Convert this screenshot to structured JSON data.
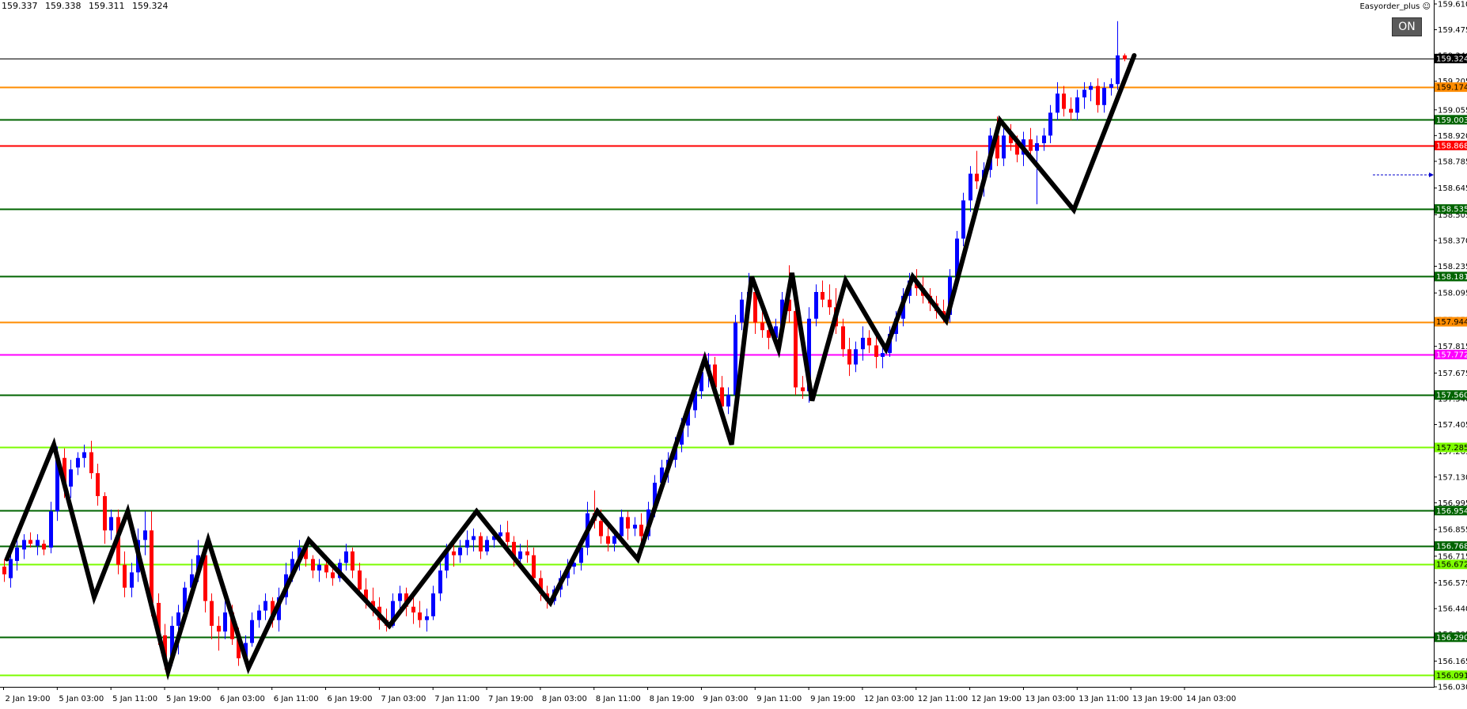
{
  "header": {
    "ohlc": [
      "159.337",
      "159.338",
      "159.311",
      "159.324"
    ],
    "ea_label": "Easyorder_plus",
    "ea_icon": "smiley-icon",
    "on_button": "ON"
  },
  "colors": {
    "bull": "#0000ff",
    "bear": "#ff0000",
    "zigzag": "#000000",
    "price_line": "#000000",
    "dark_green": "#006400",
    "orange": "#ff8c00",
    "red": "#ff0000",
    "magenta": "#ff00ff",
    "lime": "#7cfc00"
  },
  "chart_data": {
    "type": "candlestick",
    "ylim": [
      156.03,
      159.61
    ],
    "y_ticks": [
      "159.610",
      "159.475",
      "159.340",
      "159.205",
      "159.055",
      "158.920",
      "158.785",
      "158.645",
      "158.505",
      "158.370",
      "158.235",
      "158.095",
      "157.955",
      "157.815",
      "157.675",
      "157.540",
      "157.405",
      "157.265",
      "157.130",
      "156.995",
      "156.855",
      "156.715",
      "156.575",
      "156.440",
      "156.305",
      "156.165",
      "156.030"
    ],
    "x_labels": [
      "2 Jan 19:00",
      "5 Jan 03:00",
      "5 Jan 11:00",
      "5 Jan 19:00",
      "6 Jan 03:00",
      "6 Jan 11:00",
      "6 Jan 19:00",
      "7 Jan 03:00",
      "7 Jan 11:00",
      "7 Jan 19:00",
      "8 Jan 03:00",
      "8 Jan 11:00",
      "8 Jan 19:00",
      "9 Jan 03:00",
      "9 Jan 11:00",
      "9 Jan 19:00",
      "12 Jan 03:00",
      "12 Jan 11:00",
      "12 Jan 19:00",
      "13 Jan 03:00",
      "13 Jan 11:00",
      "13 Jan 19:00",
      "14 Jan 03:00"
    ],
    "current_price": "159.324",
    "levels": [
      {
        "value": 159.174,
        "label": "159.174",
        "color": "orange"
      },
      {
        "value": 159.003,
        "label": "159.003",
        "color": "dark_green"
      },
      {
        "value": 158.868,
        "label": "158.868",
        "color": "red"
      },
      {
        "value": 158.535,
        "label": "158.535",
        "color": "dark_green"
      },
      {
        "value": 158.181,
        "label": "158.181",
        "color": "dark_green"
      },
      {
        "value": 157.944,
        "label": "157.944",
        "color": "orange"
      },
      {
        "value": 157.772,
        "label": "157.772",
        "color": "magenta"
      },
      {
        "value": 157.56,
        "label": "157.560",
        "color": "dark_green"
      },
      {
        "value": 157.285,
        "label": "157.285",
        "color": "lime"
      },
      {
        "value": 156.954,
        "label": "156.954",
        "color": "dark_green"
      },
      {
        "value": 156.768,
        "label": "156.768",
        "color": "dark_green"
      },
      {
        "value": 156.672,
        "label": "156.672",
        "color": "lime"
      },
      {
        "value": 156.29,
        "label": "156.290",
        "color": "dark_green"
      },
      {
        "value": 156.091,
        "label": "156.091",
        "color": "lime"
      }
    ],
    "zigzag": [
      [
        0.5,
        156.7
      ],
      [
        7.5,
        157.3
      ],
      [
        13.5,
        156.5
      ],
      [
        18.5,
        156.95
      ],
      [
        24.5,
        156.11
      ],
      [
        30.5,
        156.8
      ],
      [
        36.5,
        156.13
      ],
      [
        45.5,
        156.8
      ],
      [
        57.5,
        156.35
      ],
      [
        70.5,
        156.95
      ],
      [
        81.5,
        156.47
      ],
      [
        88.5,
        156.95
      ],
      [
        94.5,
        156.7
      ],
      [
        104.5,
        157.75
      ],
      [
        108.5,
        157.3
      ],
      [
        111.5,
        158.18
      ],
      [
        115.5,
        157.8
      ],
      [
        117.5,
        158.2
      ],
      [
        120.5,
        157.53
      ],
      [
        125.5,
        158.16
      ],
      [
        131.5,
        157.8
      ],
      [
        135.5,
        158.18
      ],
      [
        140.5,
        157.95
      ],
      [
        148.5,
        159.0
      ],
      [
        159.5,
        158.53
      ],
      [
        168.5,
        159.34
      ]
    ],
    "candles": [
      [
        156.66,
        156.7,
        156.58,
        156.62
      ],
      [
        156.6,
        156.74,
        156.55,
        156.7
      ],
      [
        156.69,
        156.8,
        156.64,
        156.76
      ],
      [
        156.75,
        156.83,
        156.7,
        156.8
      ],
      [
        156.8,
        156.84,
        156.76,
        156.78
      ],
      [
        156.77,
        156.83,
        156.72,
        156.8
      ],
      [
        156.78,
        156.8,
        156.72,
        156.75
      ],
      [
        156.76,
        157.0,
        156.73,
        156.95
      ],
      [
        156.95,
        157.29,
        156.9,
        157.23
      ],
      [
        157.23,
        157.28,
        157.02,
        157.08
      ],
      [
        157.08,
        157.22,
        157.02,
        157.17
      ],
      [
        157.18,
        157.26,
        157.14,
        157.23
      ],
      [
        157.23,
        157.3,
        157.18,
        157.26
      ],
      [
        157.26,
        157.32,
        157.12,
        157.15
      ],
      [
        157.15,
        157.2,
        156.98,
        157.03
      ],
      [
        157.03,
        157.05,
        156.78,
        156.85
      ],
      [
        156.85,
        156.96,
        156.8,
        156.92
      ],
      [
        156.92,
        156.96,
        156.62,
        156.67
      ],
      [
        156.67,
        156.74,
        156.5,
        156.55
      ],
      [
        156.55,
        156.68,
        156.5,
        156.63
      ],
      [
        156.63,
        156.86,
        156.58,
        156.8
      ],
      [
        156.8,
        156.95,
        156.72,
        156.85
      ],
      [
        156.85,
        156.95,
        156.4,
        156.47
      ],
      [
        156.47,
        156.52,
        156.25,
        156.3
      ],
      [
        156.3,
        156.36,
        156.12,
        156.18
      ],
      [
        156.18,
        156.4,
        156.14,
        156.35
      ],
      [
        156.35,
        156.46,
        156.2,
        156.42
      ],
      [
        156.42,
        156.58,
        156.38,
        156.55
      ],
      [
        156.55,
        156.7,
        156.5,
        156.62
      ],
      [
        156.62,
        156.8,
        156.58,
        156.72
      ],
      [
        156.72,
        156.78,
        156.42,
        156.48
      ],
      [
        156.48,
        156.52,
        156.28,
        156.35
      ],
      [
        156.35,
        156.4,
        156.22,
        156.32
      ],
      [
        156.32,
        156.48,
        156.28,
        156.42
      ],
      [
        156.42,
        156.46,
        156.25,
        156.28
      ],
      [
        156.28,
        156.34,
        156.14,
        156.18
      ],
      [
        156.18,
        156.3,
        156.16,
        156.26
      ],
      [
        156.26,
        156.42,
        156.24,
        156.38
      ],
      [
        156.38,
        156.46,
        156.34,
        156.43
      ],
      [
        156.43,
        156.52,
        156.38,
        156.48
      ],
      [
        156.48,
        156.5,
        156.34,
        156.38
      ],
      [
        156.38,
        156.55,
        156.32,
        156.5
      ],
      [
        156.5,
        156.68,
        156.46,
        156.62
      ],
      [
        156.62,
        156.74,
        156.58,
        156.7
      ],
      [
        156.7,
        156.8,
        156.64,
        156.76
      ],
      [
        156.76,
        156.78,
        156.66,
        156.7
      ],
      [
        156.7,
        156.72,
        156.6,
        156.64
      ],
      [
        156.64,
        156.7,
        156.58,
        156.67
      ],
      [
        156.67,
        156.72,
        156.6,
        156.63
      ],
      [
        156.63,
        156.68,
        156.56,
        156.6
      ],
      [
        156.6,
        156.7,
        156.58,
        156.68
      ],
      [
        156.68,
        156.78,
        156.64,
        156.74
      ],
      [
        156.74,
        156.76,
        156.6,
        156.64
      ],
      [
        156.64,
        156.68,
        156.5,
        156.54
      ],
      [
        156.54,
        156.6,
        156.44,
        156.48
      ],
      [
        156.48,
        156.55,
        156.4,
        156.45
      ],
      [
        156.45,
        156.5,
        156.33,
        156.38
      ],
      [
        156.38,
        156.44,
        156.32,
        156.35
      ],
      [
        156.35,
        156.52,
        156.34,
        156.48
      ],
      [
        156.48,
        156.56,
        156.44,
        156.52
      ],
      [
        156.52,
        156.55,
        156.4,
        156.45
      ],
      [
        156.45,
        156.5,
        156.36,
        156.42
      ],
      [
        156.42,
        156.48,
        156.34,
        156.38
      ],
      [
        156.38,
        156.44,
        156.32,
        156.4
      ],
      [
        156.4,
        156.56,
        156.38,
        156.52
      ],
      [
        156.52,
        156.68,
        156.48,
        156.64
      ],
      [
        156.64,
        156.78,
        156.6,
        156.74
      ],
      [
        156.74,
        156.8,
        156.66,
        156.72
      ],
      [
        156.72,
        156.8,
        156.68,
        156.76
      ],
      [
        156.76,
        156.85,
        156.72,
        156.8
      ],
      [
        156.8,
        156.86,
        156.74,
        156.82
      ],
      [
        156.82,
        156.84,
        156.7,
        156.74
      ],
      [
        156.74,
        156.82,
        156.72,
        156.8
      ],
      [
        156.8,
        156.84,
        156.76,
        156.82
      ],
      [
        156.82,
        156.88,
        156.78,
        156.84
      ],
      [
        156.84,
        156.9,
        156.76,
        156.79
      ],
      [
        156.79,
        156.82,
        156.66,
        156.7
      ],
      [
        156.7,
        156.78,
        156.66,
        156.74
      ],
      [
        156.74,
        156.8,
        156.68,
        156.72
      ],
      [
        156.72,
        156.76,
        156.56,
        156.6
      ],
      [
        156.6,
        156.64,
        156.48,
        156.52
      ],
      [
        156.52,
        156.56,
        156.44,
        156.48
      ],
      [
        156.48,
        156.56,
        156.46,
        156.54
      ],
      [
        156.54,
        156.64,
        156.5,
        156.6
      ],
      [
        156.6,
        156.7,
        156.56,
        156.66
      ],
      [
        156.66,
        156.72,
        156.62,
        156.68
      ],
      [
        156.68,
        156.8,
        156.64,
        156.76
      ],
      [
        156.76,
        157.0,
        156.72,
        156.94
      ],
      [
        156.94,
        157.06,
        156.86,
        156.9
      ],
      [
        156.9,
        156.96,
        156.78,
        156.82
      ],
      [
        156.82,
        156.9,
        156.74,
        156.78
      ],
      [
        156.78,
        156.86,
        156.74,
        156.82
      ],
      [
        156.82,
        156.96,
        156.78,
        156.92
      ],
      [
        156.92,
        156.95,
        156.8,
        156.86
      ],
      [
        156.86,
        156.92,
        156.82,
        156.88
      ],
      [
        156.88,
        156.94,
        156.78,
        156.82
      ],
      [
        156.82,
        157.0,
        156.8,
        156.96
      ],
      [
        156.96,
        157.14,
        156.92,
        157.1
      ],
      [
        157.1,
        157.22,
        157.06,
        157.18
      ],
      [
        157.18,
        157.26,
        157.1,
        157.22
      ],
      [
        157.22,
        157.34,
        157.18,
        157.3
      ],
      [
        157.3,
        157.44,
        157.26,
        157.4
      ],
      [
        157.4,
        157.52,
        157.34,
        157.48
      ],
      [
        157.48,
        157.62,
        157.44,
        157.58
      ],
      [
        157.58,
        157.72,
        157.54,
        157.68
      ],
      [
        157.68,
        157.78,
        157.6,
        157.72
      ],
      [
        157.72,
        157.76,
        157.56,
        157.6
      ],
      [
        157.6,
        157.66,
        157.44,
        157.5
      ],
      [
        157.5,
        157.6,
        157.46,
        157.56
      ],
      [
        157.56,
        157.98,
        157.52,
        157.94
      ],
      [
        157.94,
        158.1,
        157.9,
        158.06
      ],
      [
        158.06,
        158.2,
        157.98,
        158.1
      ],
      [
        158.1,
        158.14,
        157.88,
        157.94
      ],
      [
        157.94,
        158.0,
        157.86,
        157.9
      ],
      [
        157.9,
        157.96,
        157.8,
        157.86
      ],
      [
        157.86,
        157.96,
        157.82,
        157.92
      ],
      [
        157.92,
        158.1,
        157.88,
        158.06
      ],
      [
        158.06,
        158.24,
        157.94,
        158.0
      ],
      [
        158.0,
        158.04,
        157.56,
        157.6
      ],
      [
        157.6,
        157.66,
        157.54,
        157.58
      ],
      [
        157.58,
        158.02,
        157.52,
        157.96
      ],
      [
        157.96,
        158.14,
        157.92,
        158.1
      ],
      [
        158.1,
        158.16,
        158.02,
        158.06
      ],
      [
        158.06,
        158.14,
        157.98,
        158.02
      ],
      [
        158.02,
        158.12,
        157.88,
        157.92
      ],
      [
        157.92,
        157.96,
        157.76,
        157.8
      ],
      [
        157.8,
        157.86,
        157.66,
        157.72
      ],
      [
        157.72,
        157.84,
        157.68,
        157.8
      ],
      [
        157.8,
        157.92,
        157.74,
        157.86
      ],
      [
        157.86,
        157.9,
        157.78,
        157.82
      ],
      [
        157.82,
        157.88,
        157.7,
        157.76
      ],
      [
        157.76,
        157.82,
        157.7,
        157.78
      ],
      [
        157.78,
        157.92,
        157.76,
        157.88
      ],
      [
        157.88,
        158.0,
        157.84,
        157.96
      ],
      [
        157.96,
        158.12,
        157.92,
        158.08
      ],
      [
        158.08,
        158.2,
        158.04,
        158.16
      ],
      [
        158.16,
        158.22,
        158.08,
        158.12
      ],
      [
        158.12,
        158.18,
        158.04,
        158.08
      ],
      [
        158.08,
        158.12,
        158.0,
        158.04
      ],
      [
        158.04,
        158.08,
        157.96,
        158.0
      ],
      [
        158.0,
        158.06,
        157.94,
        157.98
      ],
      [
        157.98,
        158.22,
        157.94,
        158.18
      ],
      [
        158.18,
        158.42,
        158.14,
        158.38
      ],
      [
        158.38,
        158.62,
        158.34,
        158.58
      ],
      [
        158.58,
        158.76,
        158.52,
        158.72
      ],
      [
        158.72,
        158.84,
        158.64,
        158.68
      ],
      [
        158.68,
        158.78,
        158.6,
        158.74
      ],
      [
        158.74,
        158.96,
        158.7,
        158.92
      ],
      [
        158.92,
        159.02,
        158.76,
        158.8
      ],
      [
        158.8,
        158.96,
        158.76,
        158.92
      ],
      [
        158.92,
        158.98,
        158.84,
        158.88
      ],
      [
        158.88,
        158.92,
        158.78,
        158.82
      ],
      [
        158.82,
        158.94,
        158.76,
        158.9
      ],
      [
        158.9,
        158.96,
        158.8,
        158.84
      ],
      [
        158.84,
        158.92,
        158.56,
        158.88
      ],
      [
        158.88,
        158.96,
        158.84,
        158.92
      ],
      [
        158.92,
        159.08,
        158.88,
        159.04
      ],
      [
        159.04,
        159.2,
        159.0,
        159.14
      ],
      [
        159.14,
        159.18,
        159.02,
        159.06
      ],
      [
        159.06,
        159.12,
        159.0,
        159.04
      ],
      [
        159.04,
        159.16,
        159.0,
        159.12
      ],
      [
        159.12,
        159.2,
        159.06,
        159.16
      ],
      [
        159.16,
        159.2,
        159.1,
        159.18
      ],
      [
        159.18,
        159.22,
        159.04,
        159.08
      ],
      [
        159.08,
        159.2,
        159.04,
        159.17
      ],
      [
        159.17,
        159.22,
        159.13,
        159.19
      ],
      [
        159.19,
        159.52,
        159.16,
        159.34
      ],
      [
        159.34,
        159.35,
        159.31,
        159.32
      ]
    ]
  }
}
